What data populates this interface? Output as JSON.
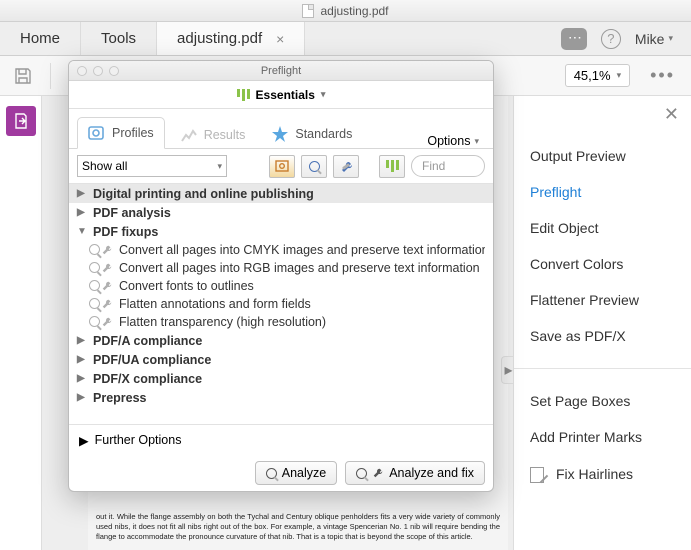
{
  "window": {
    "title": "adjusting.pdf"
  },
  "tabs": {
    "home": "Home",
    "tools": "Tools",
    "file": "adjusting.pdf"
  },
  "user": {
    "name": "Mike"
  },
  "toolbar": {
    "zoom": "45,1%"
  },
  "doc_text": "out it. While the flange assembly on both the Tychal and Century oblique penholders fits a very wide variety of commonly used nibs, it does not fit all nibs right out of the box. For example, a vintage Spencerian No. 1 nib will require bending the flange to accommodate the pronounce curvature of that nib. That is a topic that is beyond the scope of this article.",
  "right_panel": {
    "items": [
      "Output Preview",
      "Preflight",
      "Edit Object",
      "Convert Colors",
      "Flattener Preview",
      "Save as PDF/X"
    ],
    "active_index": 1,
    "lower": [
      "Set Page Boxes",
      "Add Printer Marks",
      "Fix Hairlines"
    ]
  },
  "preflight": {
    "title": "Preflight",
    "essentials": "Essentials",
    "tabs": {
      "profiles": "Profiles",
      "results": "Results",
      "standards": "Standards"
    },
    "options": "Options",
    "filter": "Show all",
    "find_placeholder": "Find",
    "groups": [
      {
        "label": "Digital printing and online publishing",
        "expanded": false
      },
      {
        "label": "PDF analysis",
        "expanded": false
      },
      {
        "label": "PDF fixups",
        "expanded": true,
        "children": [
          "Convert all pages into CMYK images and preserve text information",
          "Convert all pages into RGB images and preserve text information",
          "Convert fonts to outlines",
          "Flatten annotations and form fields",
          "Flatten transparency (high resolution)"
        ]
      },
      {
        "label": "PDF/A compliance",
        "expanded": false
      },
      {
        "label": "PDF/UA compliance",
        "expanded": false
      },
      {
        "label": "PDF/X compliance",
        "expanded": false
      },
      {
        "label": "Prepress",
        "expanded": false
      }
    ],
    "further": "Further Options",
    "analyze": "Analyze",
    "analyze_fix": "Analyze and fix"
  }
}
